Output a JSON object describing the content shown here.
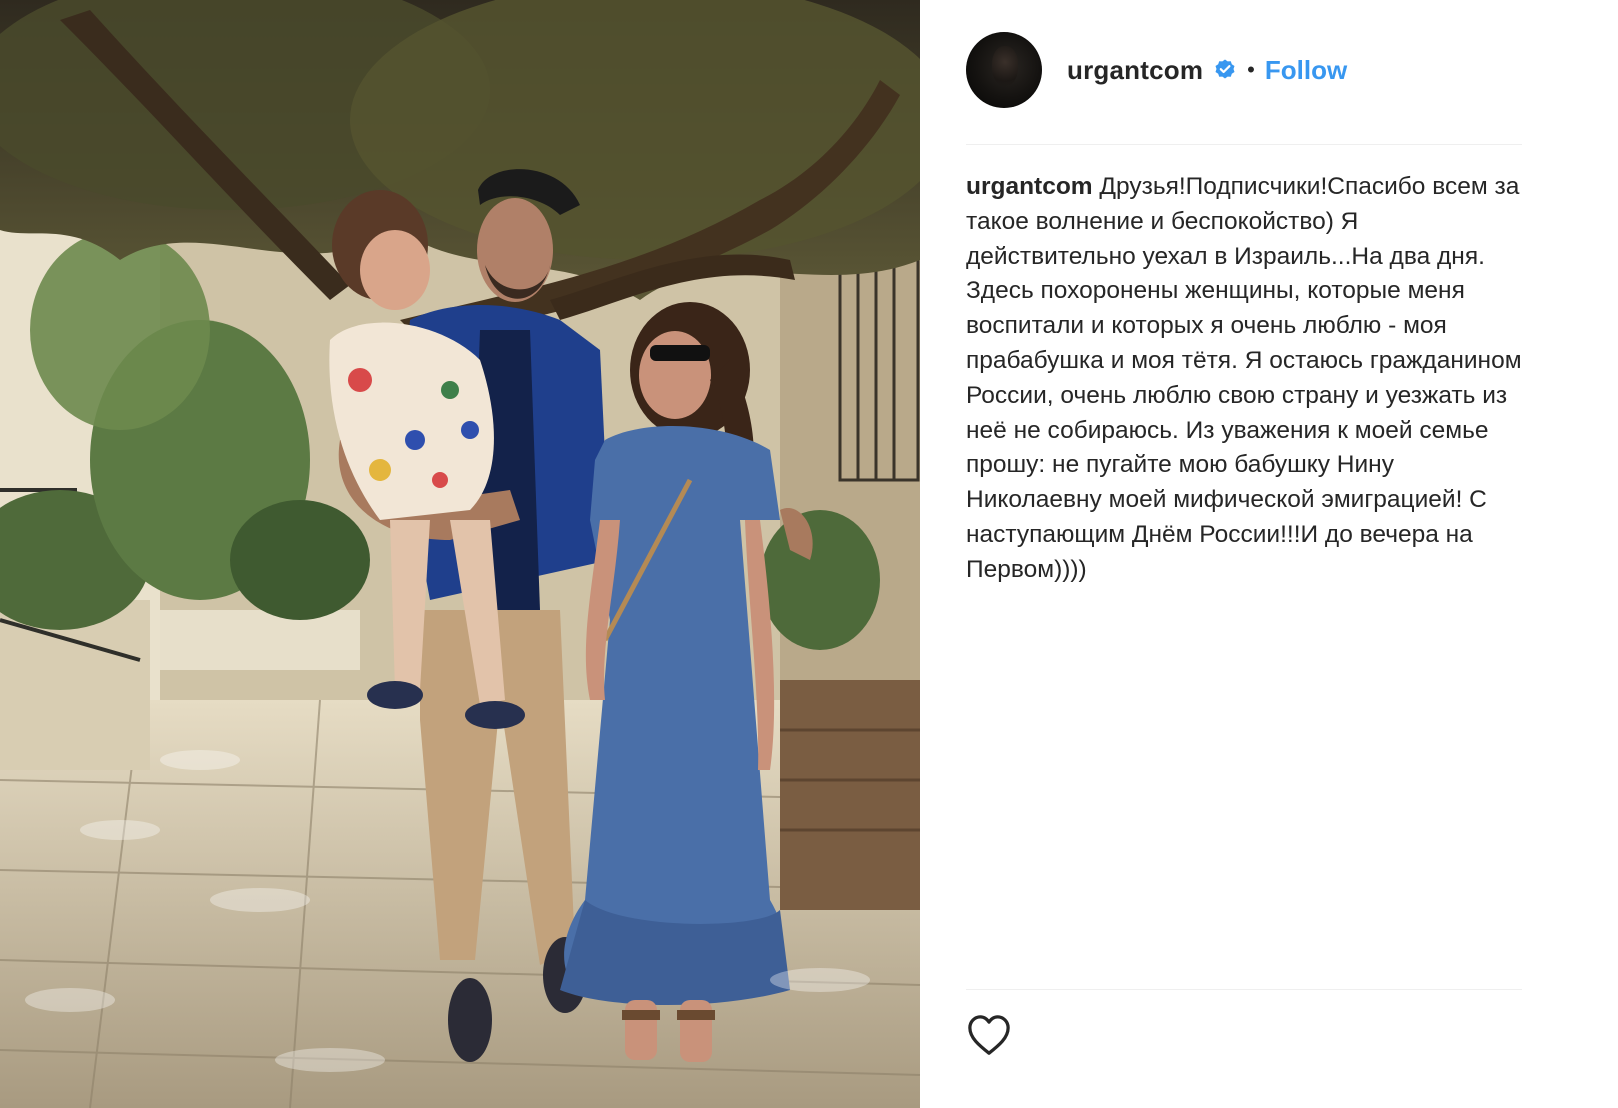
{
  "post": {
    "photo_icon": "family-photo",
    "header": {
      "username": "urgantcom",
      "verified_icon": "verified-badge-icon",
      "separator": "•",
      "follow_label": "Follow"
    },
    "caption": {
      "username": "urgantcom",
      "text": "Друзья!Подписчики!Спасибо всем за такое волнение и беспокойство) Я действительно уехал в Израиль...На два дня.\nЗдесь похоронены женщины, которые меня воспитали и которых я очень люблю - моя прабабушка и моя тётя. Я остаюсь гражданином России, очень люблю свою страну и уезжать из неё не собираюсь. Из уважения к моей семье прошу: не пугайте мою бабушку Нину Николаевну моей мифической эмиграцией! С наступающим Днём России!!!И до вечера на Первом))))"
    },
    "actions": {
      "like_icon": "heart-outline-icon"
    },
    "colors": {
      "link_blue": "#3897f0",
      "text_dark": "#262626",
      "divider": "#efefef"
    }
  }
}
